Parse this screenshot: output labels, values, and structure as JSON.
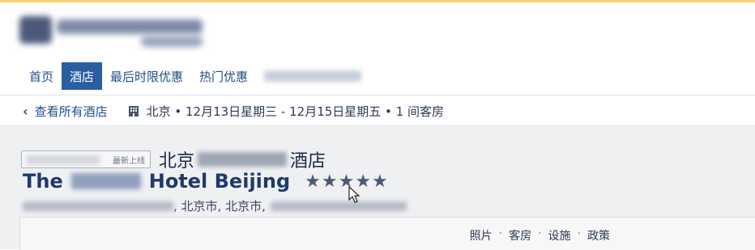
{
  "nav": {
    "items": [
      {
        "label": "首页",
        "active": false
      },
      {
        "label": "酒店",
        "active": true
      },
      {
        "label": "最后时限优惠",
        "active": false
      },
      {
        "label": "热门优惠",
        "active": false
      }
    ]
  },
  "breadcrumb": {
    "back_label": "查看所有酒店",
    "trip_summary": "北京 • 12月13日星期三 - 12月15日星期五 • 1 间客房"
  },
  "hotel": {
    "badge_label": "最新上线",
    "name_cn_prefix": "北京",
    "name_cn_suffix": "酒店",
    "name_en_prefix": "The",
    "name_en_suffix": "Hotel Beijing",
    "stars": "★★★★★",
    "address_text": ", 北京市, 北京市,"
  },
  "tabs": {
    "photos": "照片",
    "rooms": "客房",
    "facilities": "设施",
    "policies": "政策",
    "separator": "·"
  },
  "colors": {
    "accent": "#2a5ea0",
    "link": "#1f4e8a",
    "top_line": "#f5d36b",
    "panel": "#eff0f2"
  }
}
